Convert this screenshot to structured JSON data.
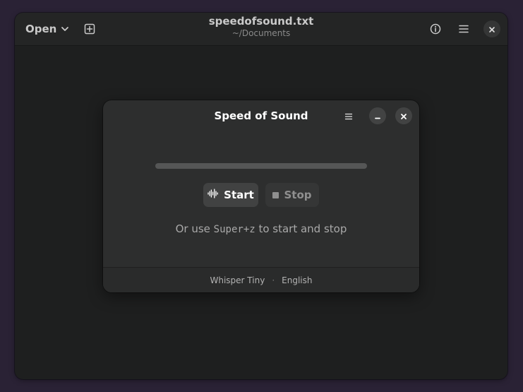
{
  "editor": {
    "open_label": "Open",
    "title": "speedofsound.txt",
    "subtitle": "~/Documents",
    "icons": {
      "open_dropdown": "chevron-down-icon",
      "new_tab": "new-tab-icon",
      "info": "info-icon",
      "menu": "hamburger-menu-icon",
      "close": "close-icon"
    }
  },
  "dialog": {
    "title": "Speed of Sound",
    "progress": 0,
    "start_label": "Start",
    "stop_label": "Stop",
    "hint_prefix": "Or use ",
    "hint_shortcut": "Super+z",
    "hint_suffix": " to start and stop",
    "footer": {
      "model": "Whisper Tiny",
      "separator": "·",
      "language": "English"
    },
    "icons": {
      "menu": "hamburger-menu-icon",
      "minimize": "minimize-icon",
      "close": "close-icon",
      "start": "waveform-icon",
      "stop": "stop-icon"
    }
  },
  "colors": {
    "desktop": "#2a2235",
    "window": "#1e1f1f",
    "dialog": "#2d2e2e",
    "accent": "#3584e4"
  }
}
